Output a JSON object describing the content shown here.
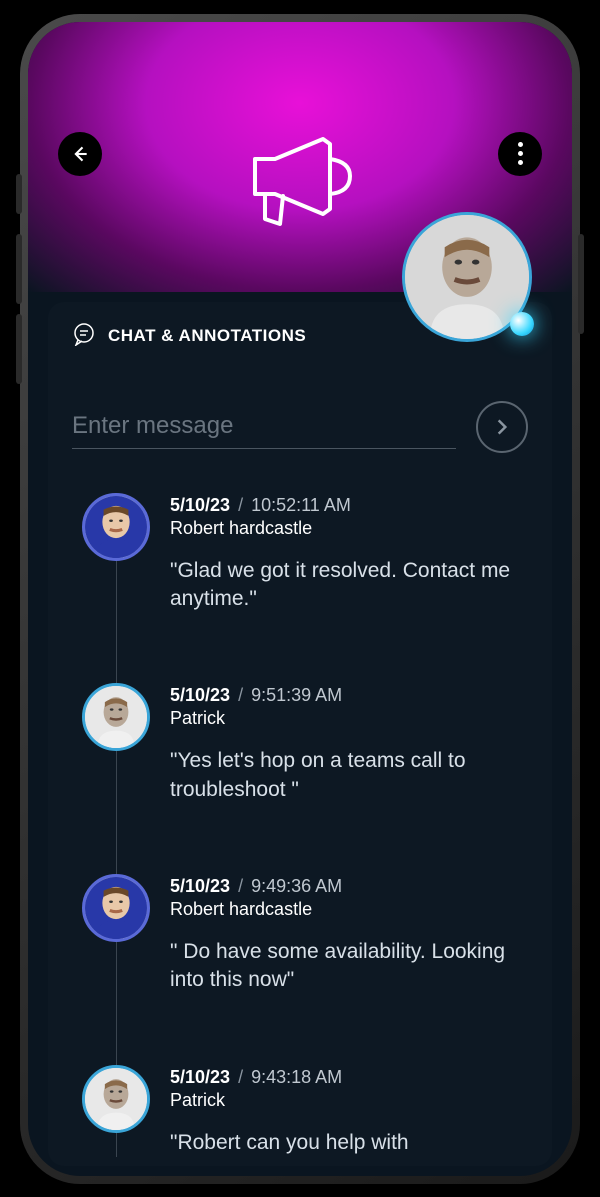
{
  "panel": {
    "title": "CHAT & ANNOTATIONS"
  },
  "input": {
    "placeholder": "Enter message"
  },
  "messages": [
    {
      "date": "5/10/23",
      "time": "10:52:11 AM",
      "author": "Robert hardcastle",
      "text": "\"Glad we got it resolved. Contact me anytime.\"",
      "avatar": "robert"
    },
    {
      "date": "5/10/23",
      "time": "9:51:39 AM",
      "author": "Patrick",
      "text": "\"Yes let's hop on a teams call to troubleshoot \"",
      "avatar": "patrick"
    },
    {
      "date": "5/10/23",
      "time": "9:49:36 AM",
      "author": "Robert hardcastle",
      "text": "\" Do have some availability. Looking into this now\"",
      "avatar": "robert"
    },
    {
      "date": "5/10/23",
      "time": "9:43:18 AM",
      "author": "Patrick",
      "text": "\"Robert can you help with",
      "avatar": "patrick"
    }
  ]
}
